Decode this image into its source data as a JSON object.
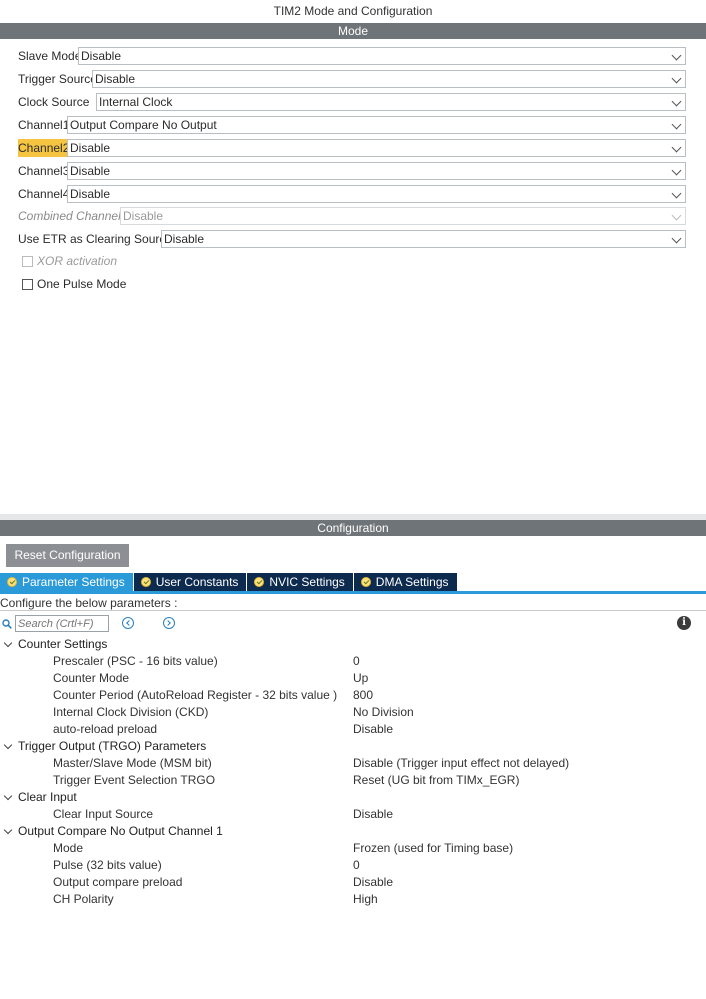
{
  "window_title": "TIM2 Mode and Configuration",
  "mode_section_title": "Mode",
  "config_section_title": "Configuration",
  "mode_rows": [
    {
      "label": "Slave Mode",
      "value": "Disable"
    },
    {
      "label": "Trigger Source",
      "value": "Disable"
    },
    {
      "label": "Clock Source",
      "value": "Internal Clock"
    },
    {
      "label": "Channel1",
      "value": "Output Compare No Output"
    },
    {
      "label": "Channel2",
      "value": "Disable",
      "highlighted": true
    },
    {
      "label": "Channel3",
      "value": "Disable"
    },
    {
      "label": "Channel4",
      "value": "Disable"
    },
    {
      "label": "Combined Channels",
      "value": "Disable",
      "disabled": true
    },
    {
      "label": "Use ETR as Clearing Source",
      "value": "Disable"
    }
  ],
  "checkboxes": [
    {
      "label": "XOR activation",
      "checked": false,
      "disabled": true
    },
    {
      "label": "One Pulse Mode",
      "checked": false,
      "disabled": false
    }
  ],
  "reset_button": "Reset Configuration",
  "tabs": [
    {
      "label": "Parameter Settings",
      "active": true
    },
    {
      "label": "User Constants",
      "active": false
    },
    {
      "label": "NVIC Settings",
      "active": false
    },
    {
      "label": "DMA Settings",
      "active": false
    }
  ],
  "configure_text": "Configure the below parameters :",
  "search": {
    "placeholder": "Search (Crtl+F)"
  },
  "info_icon_glyph": "i",
  "parameter_groups": [
    {
      "name": "Counter Settings",
      "params": [
        {
          "name": "Prescaler (PSC - 16 bits value)",
          "value": "0"
        },
        {
          "name": "Counter Mode",
          "value": "Up"
        },
        {
          "name": "Counter Period (AutoReload Register - 32 bits value )",
          "value": "800"
        },
        {
          "name": "Internal Clock Division (CKD)",
          "value": "No Division"
        },
        {
          "name": "auto-reload preload",
          "value": "Disable"
        }
      ]
    },
    {
      "name": "Trigger Output (TRGO) Parameters",
      "params": [
        {
          "name": "Master/Slave Mode (MSM bit)",
          "value": "Disable (Trigger input effect not delayed)"
        },
        {
          "name": "Trigger Event Selection TRGO",
          "value": "Reset (UG bit from TIMx_EGR)"
        }
      ]
    },
    {
      "name": "Clear Input",
      "params": [
        {
          "name": "Clear Input Source",
          "value": "Disable"
        }
      ]
    },
    {
      "name": "Output Compare No Output Channel 1",
      "params": [
        {
          "name": "Mode",
          "value": "Frozen (used for Timing base)"
        },
        {
          "name": "Pulse (32 bits value)",
          "value": "0"
        },
        {
          "name": "Output compare preload",
          "value": "Disable"
        },
        {
          "name": "CH Polarity",
          "value": "High"
        }
      ]
    }
  ],
  "colors": {
    "section_bar": "#6f7478",
    "tab_active": "#2a9ad8",
    "tab_inactive": "#0d2a4f",
    "highlight": "#f5c542",
    "reset_button": "#8c9094"
  }
}
